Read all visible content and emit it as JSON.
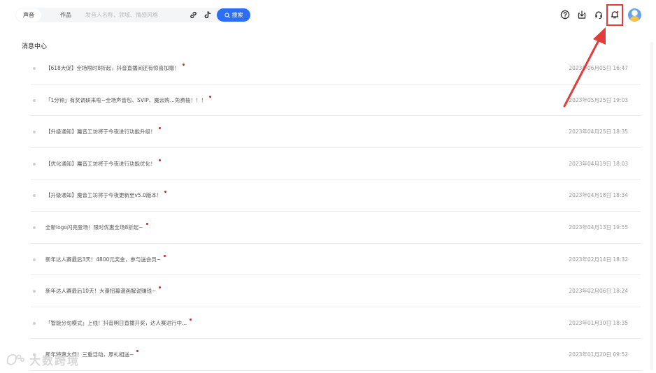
{
  "search": {
    "tabs": [
      "声音",
      "作品"
    ],
    "placeholder": "发音人名称、领域、情感风格",
    "value": "",
    "button_label": "搜索"
  },
  "header_icons": [
    "help-icon",
    "download-icon",
    "headset-icon",
    "bell-icon",
    "avatar"
  ],
  "page_title": "消息中心",
  "messages": [
    {
      "title": "【618大促】全场限时8折起，抖音直播间还有惊喜加赠！",
      "time": "2023年06月05日 16:47"
    },
    {
      "title": "「1分钟」有奖调研来啦~全场声音包、SVIP、魔云购...免费抽！！！",
      "time": "2023年05月25日 19:03"
    },
    {
      "title": "【升级通知】魔音工坊将于今夜进行功能升级！",
      "time": "2023年04月25日 18:35"
    },
    {
      "title": "【优化通知】魔音工坊将于今夜进行功能优化！",
      "time": "2023年04月19日 18:03"
    },
    {
      "title": "【升级通知】魔音工坊将于今夜更新至v5.0版本！",
      "time": "2023年04月18日 18:34"
    },
    {
      "title": "全新logo闪亮登场！限时优惠全场8折起~",
      "time": "2023年04月13日 19:55"
    },
    {
      "title": "新年达人赛最后3天！4800元奖金，参与送会员~",
      "time": "2023年02月14日 18:32"
    },
    {
      "title": "新年达人赛最后10天！大量招募漫画解说赚钱~",
      "time": "2023年02月06日 18:24"
    },
    {
      "title": "「智能分句模式」上线！抖音明日直播开奖，达人赛进行中...",
      "time": "2023年01月30日 18:35"
    },
    {
      "title": "新年特惠大促！三重活动，厚礼相送~",
      "time": "2023年01月20日 09:52"
    }
  ],
  "watermark": "大数跨境",
  "colors": {
    "accent": "#2a6ff5",
    "highlight": "#e23b3b",
    "unread_dot": "#e02020"
  }
}
